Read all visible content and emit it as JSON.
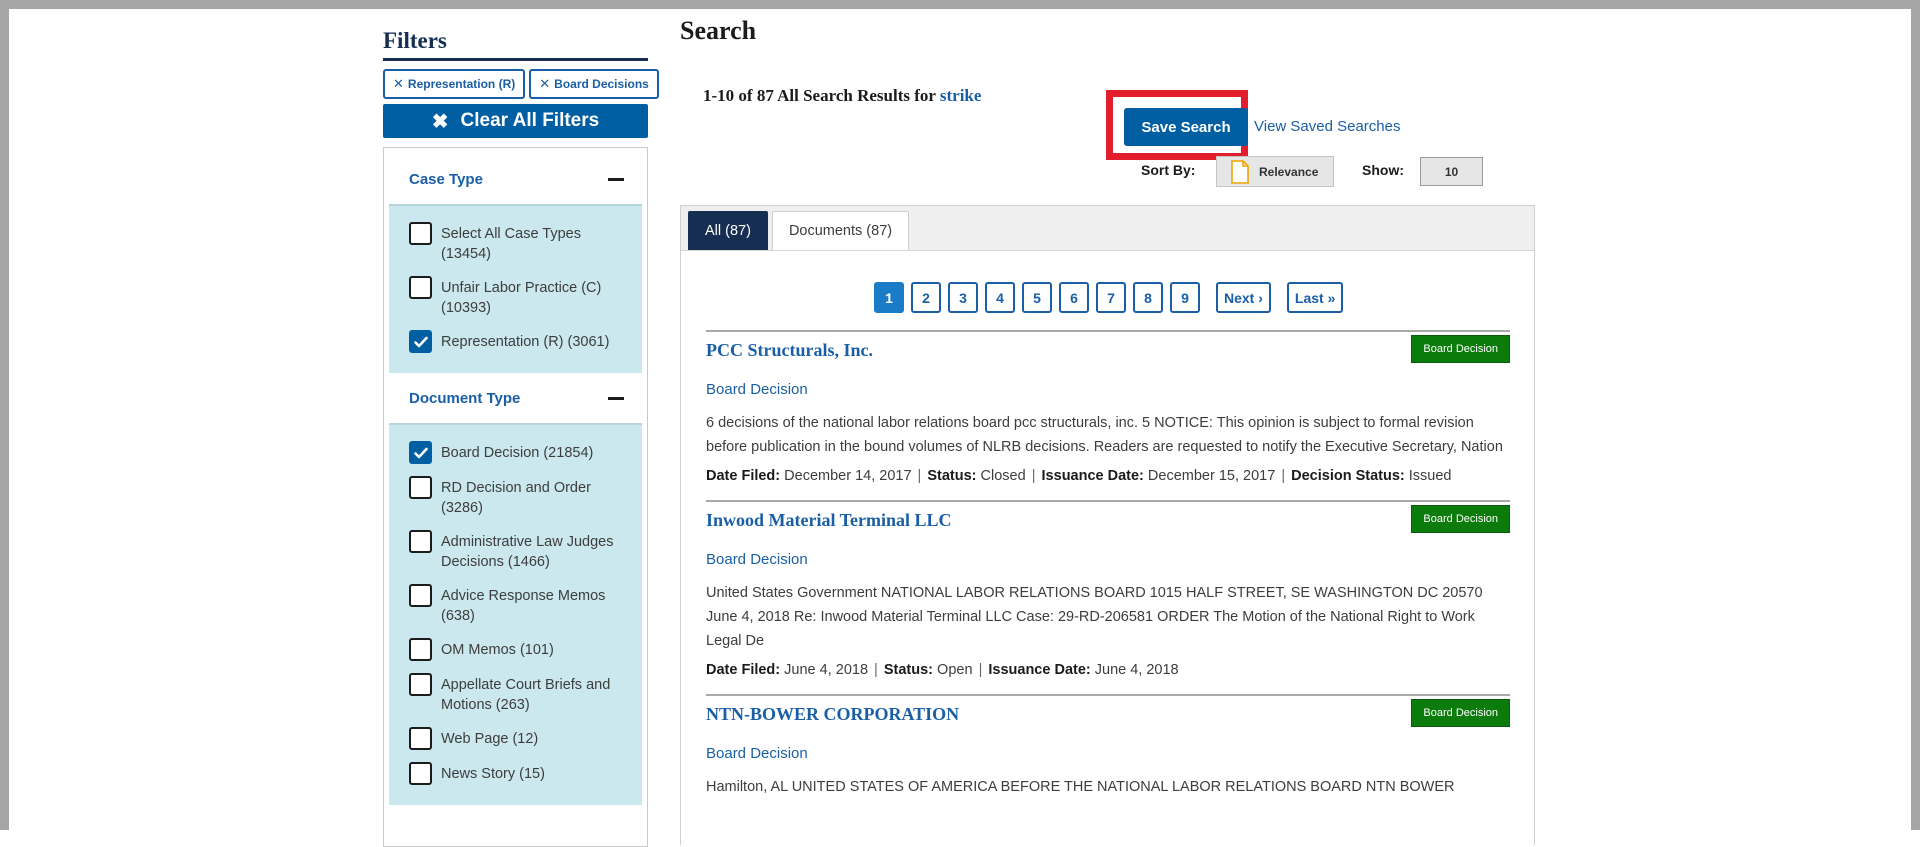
{
  "sidebar": {
    "title": "Filters",
    "chips": [
      {
        "label": "Representation (R)"
      },
      {
        "label": "Board Decisions"
      }
    ],
    "clear_all_label": "Clear All Filters",
    "case_type": {
      "heading": "Case Type",
      "items": [
        {
          "label": "Select All Case Types (13454)",
          "checked": false
        },
        {
          "label": "Unfair Labor Practice (C) (10393)",
          "checked": false
        },
        {
          "label": "Representation (R) (3061)",
          "checked": true
        }
      ]
    },
    "document_type": {
      "heading": "Document Type",
      "items": [
        {
          "label": "Board Decision (21854)",
          "checked": true
        },
        {
          "label": "RD Decision and Order (3286)",
          "checked": false
        },
        {
          "label": "Administrative Law Judges Decisions (1466)",
          "checked": false
        },
        {
          "label": "Advice Response Memos (638)",
          "checked": false
        },
        {
          "label": "OM Memos (101)",
          "checked": false
        },
        {
          "label": "Appellate Court Briefs and Motions (263)",
          "checked": false
        },
        {
          "label": "Web Page (12)",
          "checked": false
        },
        {
          "label": "News Story (15)",
          "checked": false
        }
      ]
    }
  },
  "main": {
    "page_title": "Search",
    "results_summary": "1-10 of 87 All Search Results for",
    "search_term": "strike",
    "save_search_label": "Save Search",
    "view_saved_label": "View Saved Searches",
    "sort_label": "Sort By:",
    "sort_value": "Relevance",
    "show_label": "Show:",
    "show_value": "10",
    "tabs": [
      {
        "label": "All (87)",
        "active": true
      },
      {
        "label": "Documents (87)",
        "active": false
      }
    ],
    "pagination": {
      "pages": [
        "1",
        "2",
        "3",
        "4",
        "5",
        "6",
        "7",
        "8",
        "9"
      ],
      "current": "1",
      "next_label": "Next ›",
      "last_label": "Last »"
    },
    "results": [
      {
        "title": "PCC Structurals, Inc.",
        "badge": "Board Decision",
        "type": "Board Decision",
        "snippet": "6 decisions of the national labor relations board pcc structurals, inc. 5 NOTICE: This opinion is subject to formal revision before publication in the bound volumes of NLRB decisions. Readers are requested to notify the Executive Secretary, Nation",
        "meta": [
          {
            "key": "Date Filed:",
            "value": "December 14, 2017"
          },
          {
            "key": "Status:",
            "value": "Closed"
          },
          {
            "key": "Issuance Date:",
            "value": "December 15, 2017"
          },
          {
            "key": "Decision Status:",
            "value": "Issued"
          }
        ]
      },
      {
        "title": "Inwood Material Terminal LLC",
        "badge": "Board Decision",
        "type": "Board Decision",
        "snippet": "United States Government NATIONAL LABOR RELATIONS BOARD 1015 HALF STREET, SE WASHINGTON DC 20570 June 4, 2018 Re: Inwood Material Terminal LLC Case: 29-RD-206581 ORDER The Motion of the National Right to Work Legal De",
        "meta": [
          {
            "key": "Date Filed:",
            "value": "June 4, 2018"
          },
          {
            "key": "Status:",
            "value": "Open"
          },
          {
            "key": "Issuance Date:",
            "value": "June 4, 2018"
          }
        ]
      },
      {
        "title": "NTN-BOWER CORPORATION",
        "badge": "Board Decision",
        "type": "Board Decision",
        "snippet": "Hamilton, AL UNITED STATES OF AMERICA BEFORE THE NATIONAL LABOR RELATIONS BOARD NTN BOWER",
        "meta": []
      }
    ]
  }
}
